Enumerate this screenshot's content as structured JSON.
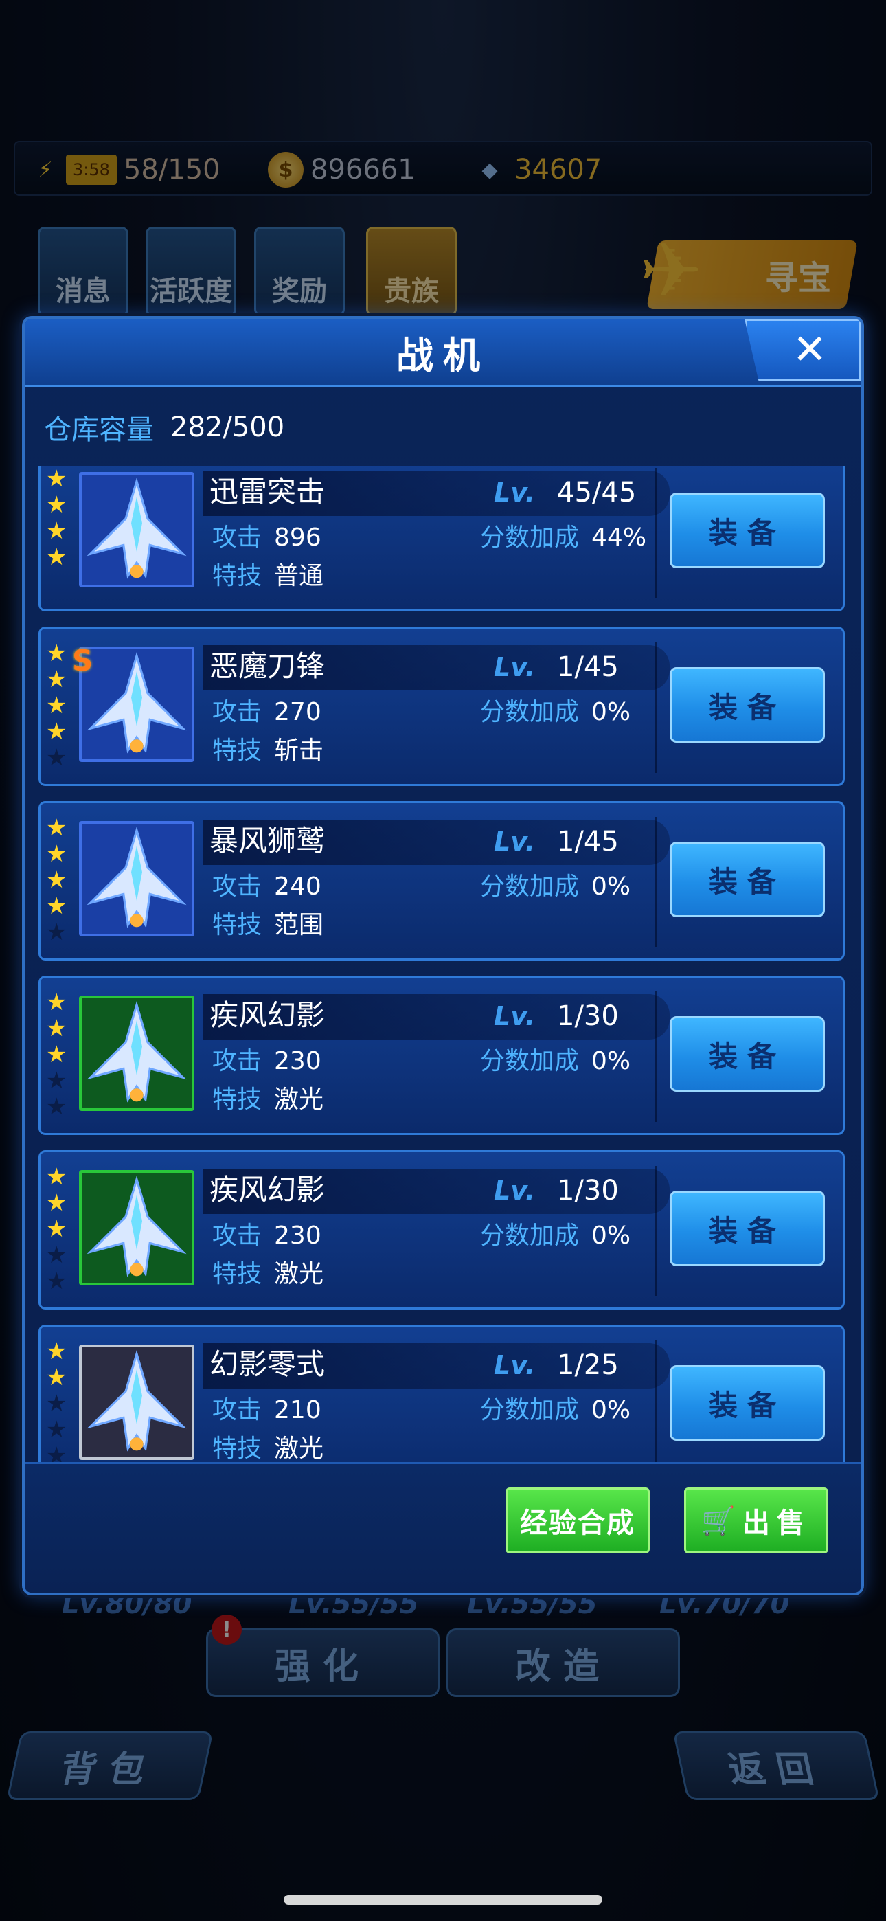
{
  "resources": {
    "energy_timer": "3:58",
    "energy": "58/150",
    "coins": "896661",
    "gems": "34607"
  },
  "top_menu": {
    "news": "消息",
    "active": "活跃度",
    "reward": "奖励",
    "vip": "贵族",
    "treasure": "寻宝"
  },
  "bg_levels": [
    "Lv.80/80",
    "Lv.55/55",
    "Lv.55/55",
    "Lv.70/70"
  ],
  "bg_buttons": {
    "strengthen": "强化",
    "modify": "改造",
    "bag": "背包",
    "back": "返回",
    "alert": "!"
  },
  "modal": {
    "title": "战机",
    "close_icon": "✕",
    "capacity_label": "仓库容量",
    "capacity_value": "282/500",
    "lv_label": "Lv.",
    "attack_label": "攻击",
    "skill_label": "特技",
    "bonus_label": "分数加成",
    "equip_label": "装备",
    "footer": {
      "exp_merge": "经验合成",
      "sell": "出售"
    }
  },
  "planes": [
    {
      "name": "迅雷突击",
      "level": "45/45",
      "attack": "896",
      "bonus": "44%",
      "skill": "普通",
      "stars": 4,
      "max_stars": 4,
      "frame": "blue",
      "grade": ""
    },
    {
      "name": "恶魔刀锋",
      "level": "1/45",
      "attack": "270",
      "bonus": "0%",
      "skill": "斩击",
      "stars": 4,
      "max_stars": 5,
      "frame": "blue",
      "grade": "S"
    },
    {
      "name": "暴风狮鹫",
      "level": "1/45",
      "attack": "240",
      "bonus": "0%",
      "skill": "范围",
      "stars": 4,
      "max_stars": 5,
      "frame": "blue",
      "grade": ""
    },
    {
      "name": "疾风幻影",
      "level": "1/30",
      "attack": "230",
      "bonus": "0%",
      "skill": "激光",
      "stars": 3,
      "max_stars": 5,
      "frame": "green",
      "grade": ""
    },
    {
      "name": "疾风幻影",
      "level": "1/30",
      "attack": "230",
      "bonus": "0%",
      "skill": "激光",
      "stars": 3,
      "max_stars": 5,
      "frame": "green",
      "grade": ""
    },
    {
      "name": "幻影零式",
      "level": "1/25",
      "attack": "210",
      "bonus": "0%",
      "skill": "激光",
      "stars": 2,
      "max_stars": 5,
      "frame": "silver",
      "grade": ""
    }
  ],
  "colors": {
    "accent_blue": "#4fb4ff",
    "equip_button": "#1f8ee8",
    "footer_button": "#1eae23",
    "star": "#ffd52a"
  }
}
